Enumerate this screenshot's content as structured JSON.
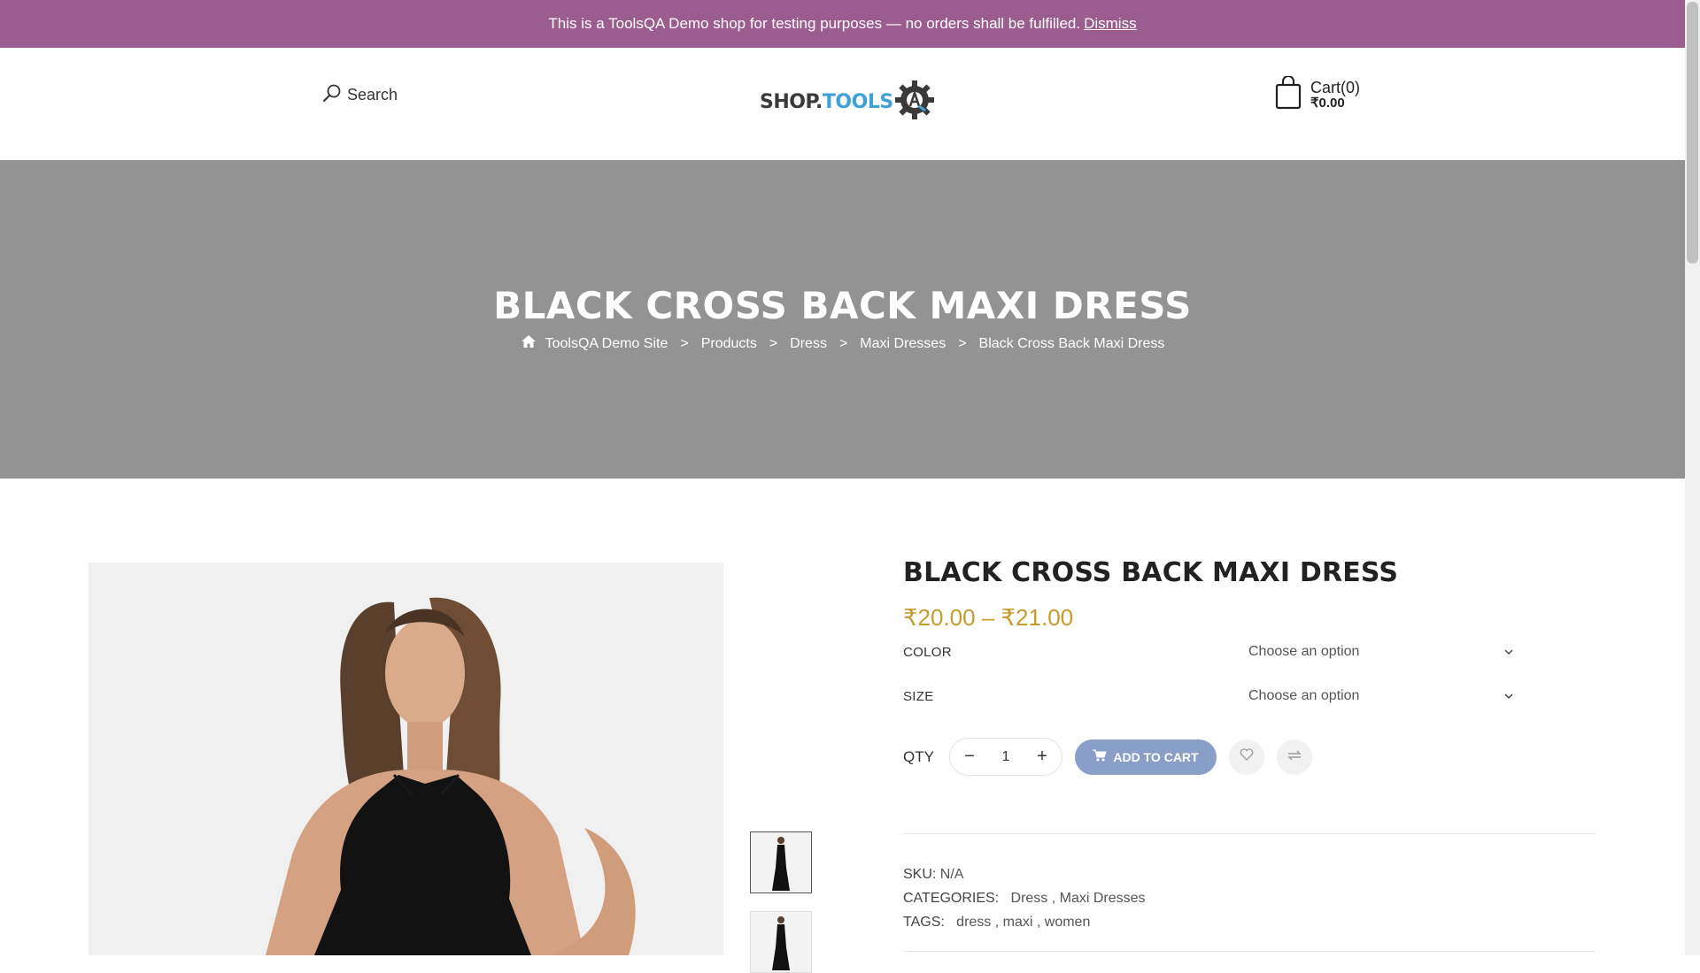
{
  "notice": {
    "text": "This is a ToolsQA Demo shop for testing purposes — no orders shall be fulfilled.",
    "dismiss_label": "Dismiss"
  },
  "header": {
    "search_label": "Search",
    "logo_text_main": "SHOP.",
    "logo_text_accent": "TOOLS",
    "cart_label": "Cart(0)",
    "cart_total": "₹0.00"
  },
  "hero": {
    "title": "BLACK CROSS BACK MAXI DRESS",
    "breadcrumb": [
      "ToolsQA Demo Site",
      "Products",
      "Dress",
      "Maxi Dresses",
      "Black Cross Back Maxi Dress"
    ],
    "separator": ">"
  },
  "product": {
    "title": "BLACK CROSS BACK MAXI DRESS",
    "price": "₹20.00 – ₹21.00",
    "color_label": "COLOR",
    "color_placeholder": "Choose an option",
    "size_label": "SIZE",
    "size_placeholder": "Choose an option",
    "qty_label": "QTY",
    "qty_value": "1",
    "add_to_cart_label": "ADD TO CART",
    "sku_label": "SKU:",
    "sku_value": "N/A",
    "categories_label": "CATEGORIES:",
    "categories": [
      "Dress",
      "Maxi Dresses"
    ],
    "tags_label": "TAGS:",
    "tags": [
      "dress",
      "maxi",
      "women"
    ]
  },
  "icons": {
    "search": "search-icon",
    "cart": "shopping-bag-icon",
    "home": "home-icon",
    "wishlist": "heart-icon",
    "compare": "compare-icon",
    "add_to_cart": "cart-icon"
  },
  "colors": {
    "notice_bg": "#9b5c8f",
    "hero_bg": "#939393",
    "price": "#c69c2d",
    "add_to_cart_bg": "#8a9fc8",
    "logo_accent": "#3fa1d8"
  }
}
